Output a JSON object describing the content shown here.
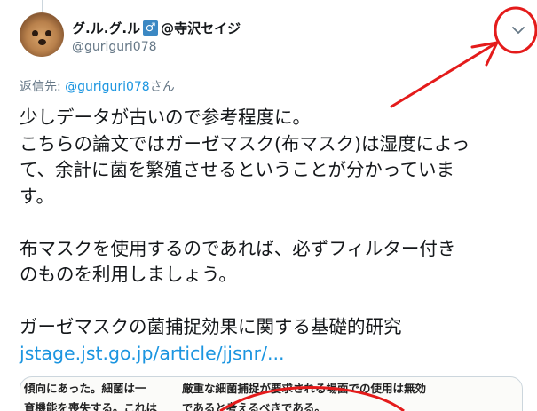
{
  "tweet": {
    "display_name": "グ.ル.グ.ル",
    "badge_symbol": "♂",
    "name_suffix": "@寺沢セイジ",
    "handle": "@guriguri078",
    "reply_prefix": "返信先: ",
    "reply_handle": "@guriguri078",
    "reply_suffix": "さん",
    "lines": [
      "少しデータが古いので参考程度に。",
      "こちらの論文ではガーゼマスク(布マスク)は湿度によっ",
      "て、余計に菌を繁殖させるということが分かっていま",
      "す。",
      "",
      "布マスクを使用するのであれば、必ずフィルター付き",
      "のものを利用しましょう。",
      "",
      "ガーゼマスクの菌捕捉効果に関する基礎的研究"
    ],
    "link_text": "jstage.jst.go.jp/article/jjsnr/...",
    "media": {
      "left_lines": [
        "傾向にあった。細菌は一",
        "育機能を喪失する。これは"
      ],
      "right_lines": [
        "厳重な細菌捕捉が要求される場面での使用は無効",
        "であると考えるべきである。"
      ]
    }
  },
  "icons": {
    "caret": "chevron-down-icon",
    "badge": "male-sign-icon"
  },
  "colors": {
    "link": "#1b95e0",
    "muted": "#657786",
    "annotation": "#e41b1b",
    "badge": "#3b88c3"
  }
}
